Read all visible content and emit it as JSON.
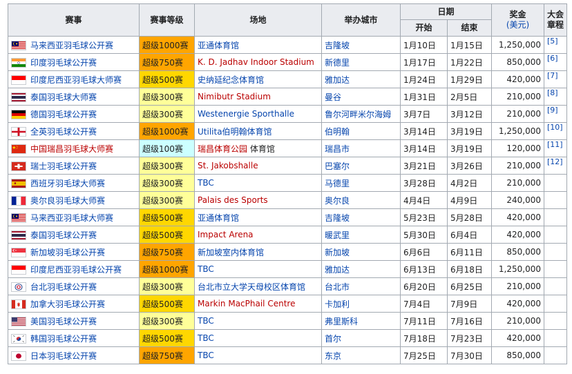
{
  "headers": {
    "event": "赛事",
    "level": "赛事等级",
    "venue": "场地",
    "city": "举办城市",
    "date": "日期",
    "start": "开始",
    "end": "结束",
    "prize": "奖金",
    "prize_unit": "(美元)",
    "charter_line1": "大会",
    "charter_line2": "章程"
  },
  "level_colors": {
    "超级1000赛": "#ffa500",
    "超级750赛": "#ffa500",
    "超级500赛": "#ffd700",
    "超级300赛": "#ffff99",
    "超级100赛": "#ccffff"
  },
  "rows": [
    {
      "flag": "malaysia-flag-icon",
      "event": "马来西亚羽毛球公开赛",
      "event_red": false,
      "level": "超级1000赛",
      "venue": "亚通体育馆",
      "venue_extra": "",
      "venue_red": false,
      "city": "吉隆坡",
      "start": "1月10日",
      "end": "1月15日",
      "prize": "1,250,000",
      "ref": "[5]"
    },
    {
      "flag": "india-flag-icon",
      "event": "印度羽毛球公开赛",
      "event_red": false,
      "level": "超级750赛",
      "venue": "K. D. Jadhav Indoor Stadium",
      "venue_extra": "",
      "venue_red": true,
      "city": "新德里",
      "start": "1月17日",
      "end": "1月22日",
      "prize": "850,000",
      "ref": "[6]"
    },
    {
      "flag": "indonesia-flag-icon",
      "event": "印度尼西亚羽毛球大师赛",
      "event_red": false,
      "level": "超级500赛",
      "venue": "史纳延纪念体育馆",
      "venue_extra": "",
      "venue_red": false,
      "city": "雅加达",
      "start": "1月24日",
      "end": "1月29日",
      "prize": "420,000",
      "ref": "[7]"
    },
    {
      "flag": "thailand-flag-icon",
      "event": "泰国羽毛球大师赛",
      "event_red": false,
      "level": "超级300赛",
      "venue": "Nimibutr Stadium",
      "venue_extra": "",
      "venue_red": true,
      "city": "曼谷",
      "start": "1月31日",
      "end": "2月5日",
      "prize": "210,000",
      "ref": "[8]"
    },
    {
      "flag": "germany-flag-icon",
      "event": "德国羽毛球公开赛",
      "event_red": false,
      "level": "超级300赛",
      "venue": "Westenergie Sporthalle",
      "venue_extra": "",
      "venue_red": false,
      "city": "鲁尔河畔米尔海姆",
      "start": "3月7日",
      "end": "3月12日",
      "prize": "210,000",
      "ref": "[9]"
    },
    {
      "flag": "england-flag-icon",
      "event": "全英羽毛球公开赛",
      "event_red": false,
      "level": "超级1000赛",
      "venue": "Utilita伯明翰体育馆",
      "venue_extra": "",
      "venue_red": false,
      "city": "伯明翰",
      "start": "3月14日",
      "end": "3月19日",
      "prize": "1,250,000",
      "ref": "[10]"
    },
    {
      "flag": "china-flag-icon",
      "event": "中国瑞昌羽毛球大师赛",
      "event_red": true,
      "level": "超级100赛",
      "venue": "瑞昌体育公园",
      "venue_extra": " 体育馆",
      "venue_red": true,
      "city": "瑞昌市",
      "start": "3月14日",
      "end": "3月19日",
      "prize": "120,000",
      "ref": "[11]"
    },
    {
      "flag": "switzerland-flag-icon",
      "event": "瑞士羽毛球公开赛",
      "event_red": false,
      "level": "超级300赛",
      "venue": "St. Jakobshalle",
      "venue_extra": "",
      "venue_red": true,
      "city": "巴塞尔",
      "start": "3月21日",
      "end": "3月26日",
      "prize": "210,000",
      "ref": "[12]"
    },
    {
      "flag": "spain-flag-icon",
      "event": "西班牙羽毛球大师赛",
      "event_red": false,
      "level": "超级300赛",
      "venue": "TBC",
      "venue_extra": "",
      "venue_red": false,
      "city": "马德里",
      "start": "3月28日",
      "end": "4月2日",
      "prize": "210,000",
      "ref": ""
    },
    {
      "flag": "france-flag-icon",
      "event": "奥尔良羽毛球大师赛",
      "event_red": false,
      "level": "超级300赛",
      "venue": "Palais des Sports",
      "venue_extra": "",
      "venue_red": true,
      "city": "奥尔良",
      "start": "4月4日",
      "end": "4月9日",
      "prize": "240,000",
      "ref": ""
    },
    {
      "flag": "malaysia-flag-icon",
      "event": "马来西亚羽毛球大师赛",
      "event_red": false,
      "level": "超级500赛",
      "venue": "亚通体育馆",
      "venue_extra": "",
      "venue_red": false,
      "city": "吉隆坡",
      "start": "5月23日",
      "end": "5月28日",
      "prize": "420,000",
      "ref": ""
    },
    {
      "flag": "thailand-flag-icon",
      "event": "泰国羽毛球公开赛",
      "event_red": false,
      "level": "超级500赛",
      "venue": "Impact Arena",
      "venue_extra": "",
      "venue_red": true,
      "city": "暖武里",
      "start": "5月30日",
      "end": "6月4日",
      "prize": "420,000",
      "ref": ""
    },
    {
      "flag": "singapore-flag-icon",
      "event": "新加坡羽毛球公开赛",
      "event_red": false,
      "level": "超级750赛",
      "venue": "新加坡室内体育馆",
      "venue_extra": "",
      "venue_red": false,
      "city": "新加坡",
      "start": "6月6日",
      "end": "6月11日",
      "prize": "850,000",
      "ref": ""
    },
    {
      "flag": "indonesia-flag-icon",
      "event": "印度尼西亚羽毛球公开赛",
      "event_red": false,
      "level": "超级1000赛",
      "venue": "TBC",
      "venue_extra": "",
      "venue_red": false,
      "city": "雅加达",
      "start": "6月13日",
      "end": "6月18日",
      "prize": "1,250,000",
      "ref": ""
    },
    {
      "flag": "chinese-taipei-flag-icon",
      "event": "台北羽毛球公开赛",
      "event_red": false,
      "level": "超级300赛",
      "venue": "台北市立大学天母校区体育馆",
      "venue_extra": "",
      "venue_red": false,
      "city": "台北市",
      "start": "6月20日",
      "end": "6月25日",
      "prize": "210,000",
      "ref": ""
    },
    {
      "flag": "canada-flag-icon",
      "event": "加拿大羽毛球公开赛",
      "event_red": false,
      "level": "超级500赛",
      "venue": "Markin MacPhail Centre",
      "venue_extra": "",
      "venue_red": true,
      "city": "卡加利",
      "start": "7月4日",
      "end": "7月9日",
      "prize": "420,000",
      "ref": ""
    },
    {
      "flag": "usa-flag-icon",
      "event": "美国羽毛球公开赛",
      "event_red": false,
      "level": "超级300赛",
      "venue": "TBC",
      "venue_extra": "",
      "venue_red": false,
      "city": "弗里斯科",
      "start": "7月11日",
      "end": "7月16日",
      "prize": "210,000",
      "ref": ""
    },
    {
      "flag": "korea-flag-icon",
      "event": "韩国羽毛球公开赛",
      "event_red": false,
      "level": "超级500赛",
      "venue": "TBC",
      "venue_extra": "",
      "venue_red": false,
      "city": "首尔",
      "start": "7月18日",
      "end": "7月23日",
      "prize": "420,000",
      "ref": ""
    },
    {
      "flag": "japan-flag-icon",
      "event": "日本羽毛球公开赛",
      "event_red": false,
      "level": "超级750赛",
      "venue": "TBC",
      "venue_extra": "",
      "venue_red": false,
      "city": "东京",
      "start": "7月25日",
      "end": "7月30日",
      "prize": "850,000",
      "ref": ""
    }
  ]
}
